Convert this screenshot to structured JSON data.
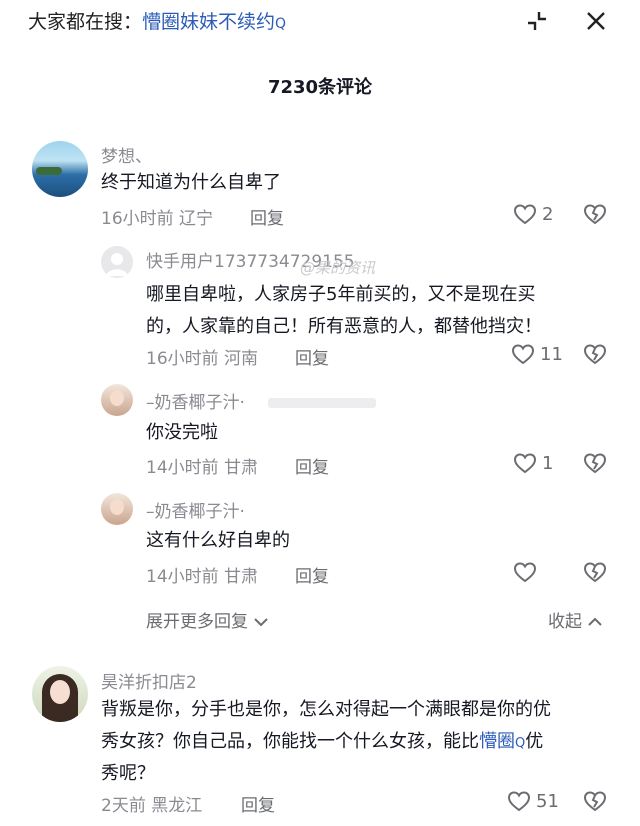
{
  "top": {
    "search_prefix": "大家都在搜：",
    "search_keyword": "懵圈妹妹不续约",
    "search_glyph": "Q"
  },
  "header": {
    "count_label": "7230条评论"
  },
  "comments": [
    {
      "user": "梦想、",
      "text": "终于知道为什么自卑了",
      "time": "16小时前",
      "location": "辽宁",
      "reply_label": "回复",
      "likes": "2"
    },
    {
      "user": "快手用户1737734729155",
      "text_line1": "哪里自卑啦，人家房子5年前买的，又不是现在买",
      "text_line2": "的，人家靠的自己！所有恶意的人，都替他挡灾！",
      "time": "16小时前",
      "location": "河南",
      "reply_label": "回复",
      "likes": "11"
    },
    {
      "user": "–奶香椰子汁·",
      "text": "你没完啦",
      "time": "14小时前",
      "location": "甘肃",
      "reply_label": "回复",
      "likes": "1"
    },
    {
      "user": "–奶香椰子汁·",
      "text": "这有什么好自卑的",
      "time": "14小时前",
      "location": "甘肃",
      "reply_label": "回复",
      "likes": ""
    },
    {
      "user": "昊洋折扣店2",
      "text_line1": "背叛是你，分手也是你，怎么对得起一个满眼都是你的优",
      "text_line2_pre": "秀女孩？你自己品，你能找一个什么女孩，能比",
      "text_line2_kw": "懵圈",
      "text_line2_post": "优",
      "text_line3": "秀呢？",
      "time": "2天前",
      "location": "黑龙江",
      "reply_label": "回复",
      "likes": "51"
    }
  ],
  "thread": {
    "expand_label": "展开更多回复",
    "collapse_label": "收起"
  },
  "watermark": "@果的资讯",
  "colors": {
    "accent": "#2c5cb8",
    "text": "#161823",
    "muted": "#8a8b91"
  }
}
